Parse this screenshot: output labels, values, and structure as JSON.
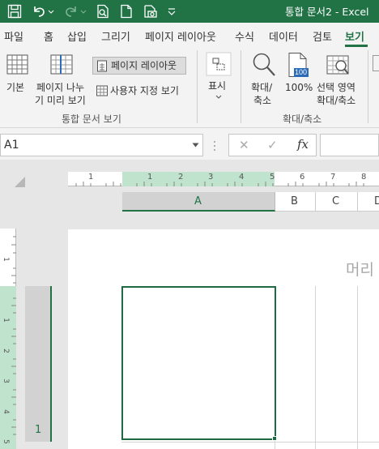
{
  "titlebar": {
    "title": "통합 문서2  -  Excel",
    "icons": [
      "save-icon",
      "undo-icon",
      "redo-icon",
      "print-preview-icon",
      "new-file-icon",
      "camera-icon",
      "customize-qat-icon"
    ]
  },
  "tabs": [
    {
      "label": "파일"
    },
    {
      "label": "홈"
    },
    {
      "label": "삽입"
    },
    {
      "label": "그리기"
    },
    {
      "label": "페이지 레이아웃"
    },
    {
      "label": "수식"
    },
    {
      "label": "데이터"
    },
    {
      "label": "검토"
    },
    {
      "label": "보기",
      "active": true
    }
  ],
  "ribbon": {
    "normal_label": "기본",
    "page_break_label_1": "페이지 나누",
    "page_break_label_2": "기 미리 보기",
    "page_layout_label": "페이지 레이아웃",
    "custom_views_label": "사용자 지정 보기",
    "group_workbook_views": "통합 문서 보기",
    "show_label": "표시",
    "zoom_label_1": "확대/",
    "zoom_label_2": "축소",
    "zoom100_label": "100%",
    "zoom100_icon_text": "100",
    "zoom_selection_label_1": "선택 영역",
    "zoom_selection_label_2": "확대/축소",
    "group_zoom": "확대/축소"
  },
  "formula_bar": {
    "name_box": "A1",
    "cancel_icon": "✕",
    "enter_icon": "✓",
    "fx_label": "fx"
  },
  "sheet": {
    "columns": [
      "A",
      "B",
      "C",
      "D"
    ],
    "row_number": "1",
    "header_placeholder": "머리",
    "ruler_top": [
      "1",
      "1",
      "2",
      "3",
      "4",
      "5",
      "6",
      "7",
      "8"
    ],
    "ruler_left": [
      "1",
      "1",
      "2",
      "3",
      "4",
      "5"
    ]
  },
  "colors": {
    "excel_green": "#217346",
    "selection_green": "#1e6b41",
    "ruler_green": "#bfe3cc"
  }
}
